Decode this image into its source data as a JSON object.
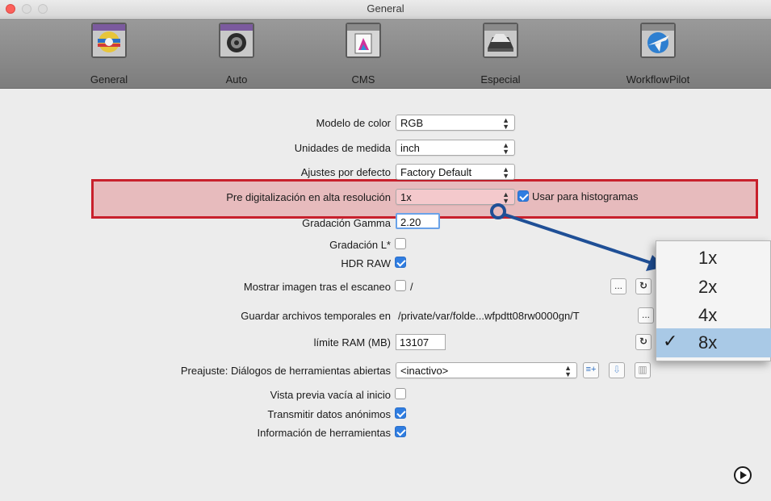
{
  "window": {
    "title": "General"
  },
  "toolbar": {
    "items": [
      {
        "label": "General",
        "icon": "general-icon"
      },
      {
        "label": "Auto",
        "icon": "auto-icon"
      },
      {
        "label": "CMS",
        "icon": "cms-icon"
      },
      {
        "label": "Especial",
        "icon": "especial-icon"
      },
      {
        "label": "WorkflowPilot",
        "icon": "workflowpilot-icon"
      }
    ]
  },
  "settings": {
    "color_model": {
      "label": "Modelo de color",
      "value": "RGB"
    },
    "units": {
      "label": "Unidades de medida",
      "value": "inch"
    },
    "defaults": {
      "label": "Ajustes por defecto",
      "value": "Factory Default"
    },
    "prescan": {
      "label": "Pre digitalización en alta resolución",
      "value": "1x",
      "histogram_label": "Usar para histogramas",
      "histogram_checked": true
    },
    "gamma": {
      "label": "Gradación Gamma",
      "value": "2.20"
    },
    "l_star": {
      "label": "Gradación L*",
      "checked": false
    },
    "hdr_raw": {
      "label": "HDR RAW",
      "checked": true
    },
    "show_image": {
      "label": "Mostrar imagen tras el escaneo",
      "checked": false,
      "path": "/",
      "browse_label": "..."
    },
    "temp_files": {
      "label": "Guardar archivos temporales en",
      "path": "/private/var/folde...wfpdtt08rw0000gn/T",
      "browse_label": "..."
    },
    "ram_limit": {
      "label": "límite RAM (MB)",
      "value": "13107"
    },
    "preset": {
      "label": "Preajuste: Diálogos de herramientas abiertas",
      "value": "<inactivo>"
    },
    "empty_preview": {
      "label": "Vista previa vacía al inicio",
      "checked": false
    },
    "anon_data": {
      "label": "Transmitir datos anónimos",
      "checked": true
    },
    "tool_info": {
      "label": "Información de herramientas",
      "checked": true
    }
  },
  "popup_menu": {
    "items": [
      "1x",
      "2x",
      "4x",
      "8x"
    ],
    "selected": "8x",
    "check": "✓"
  },
  "colors": {
    "highlight_border": "#c8202c",
    "arrow": "#1f4f96",
    "checkbox_on": "#2f7de1",
    "menu_selected": "#a9c9e6"
  }
}
